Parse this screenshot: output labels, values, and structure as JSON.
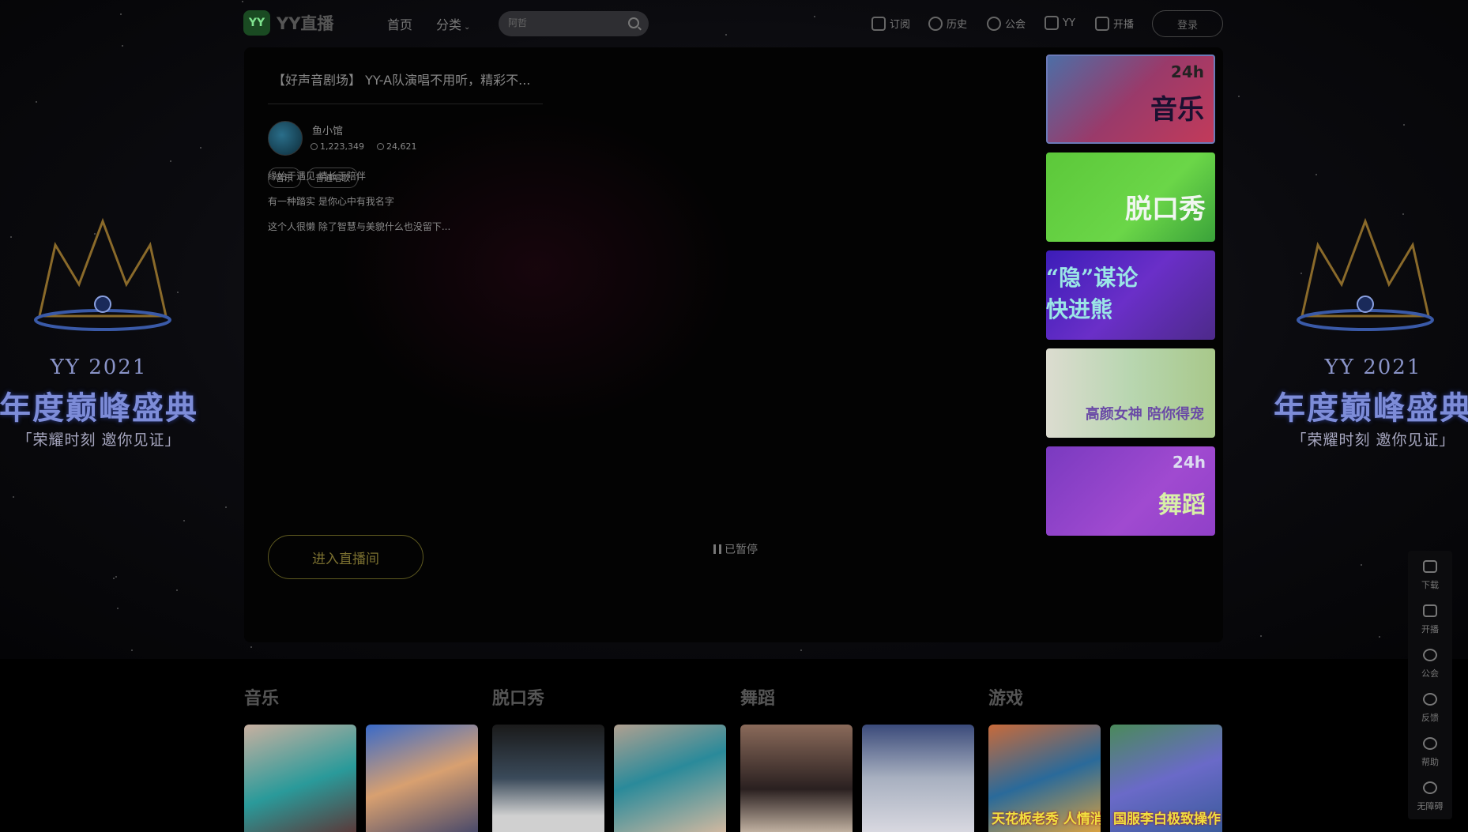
{
  "header": {
    "logo_mark": "YY",
    "logo_text": "YY直播",
    "nav_home": "首页",
    "nav_category": "分类",
    "search_placeholder": "阿哲",
    "top_links": [
      "订阅",
      "历史",
      "公会",
      "YY",
      "开播"
    ],
    "login": "登录"
  },
  "festival": {
    "line1": "YY 2021",
    "line2": "年度巅峰盛典",
    "line3": "「荣耀时刻 邀你见证」"
  },
  "room": {
    "title": "【好声音剧场】 YY-A队演唱不用听，精彩不...",
    "streamer": "鱼小馆",
    "viewers": "1,223,349",
    "likes": "24,621",
    "tags": [
      "音乐",
      "普通唱歌"
    ],
    "desc": [
      "缘始于遇见 情长于陪伴",
      "有一种踏实 是你心中有我名字",
      "这个人很懒 除了智慧与美貌什么也没留下..."
    ],
    "enter_button": "进入直播间",
    "paused": "已暂停"
  },
  "banners": [
    {
      "text": "音乐",
      "badge": "24h"
    },
    {
      "text": "脱口秀",
      "badge": ""
    },
    {
      "text": "“隐”谋论 快进熊",
      "badge": ""
    },
    {
      "text": "高颜女神 陪你得宠",
      "badge": ""
    },
    {
      "text": "舞蹈",
      "badge": "24h"
    }
  ],
  "categories": [
    "音乐",
    "脱口秀",
    "舞蹈",
    "游戏"
  ],
  "thumb_captions": [
    "",
    "",
    "",
    "",
    "",
    "",
    "天花板老秀 人情消失术",
    "国服李白极致操作"
  ],
  "float_bar": [
    "下载",
    "开播",
    "公会",
    "反馈",
    "帮助",
    "无障碍"
  ]
}
